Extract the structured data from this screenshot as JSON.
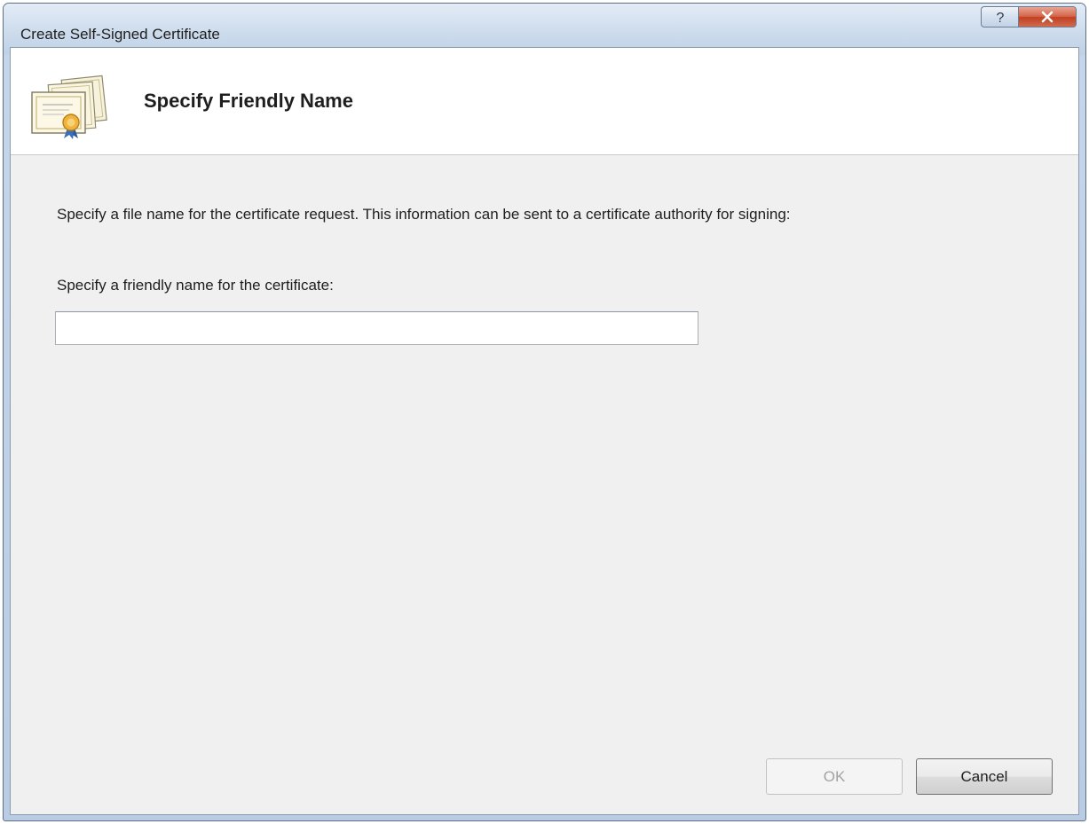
{
  "window": {
    "title": "Create Self-Signed Certificate",
    "help_glyph": "?",
    "close_glyph": "X"
  },
  "header": {
    "title": "Specify Friendly Name",
    "icon": "certificate-icon"
  },
  "body": {
    "instructions": "Specify a file name for the certificate request.  This information can be sent to a certificate authority for signing:",
    "field_label": "Specify a friendly name for the certificate:",
    "friendly_name_value": "",
    "friendly_name_placeholder": ""
  },
  "buttons": {
    "ok_label": "OK",
    "ok_enabled": false,
    "cancel_label": "Cancel"
  },
  "colors": {
    "title_bar": "#c6d6ea",
    "close_button": "#c23f22",
    "dialog_background": "#f0f0f0",
    "header_band": "#ffffff"
  }
}
